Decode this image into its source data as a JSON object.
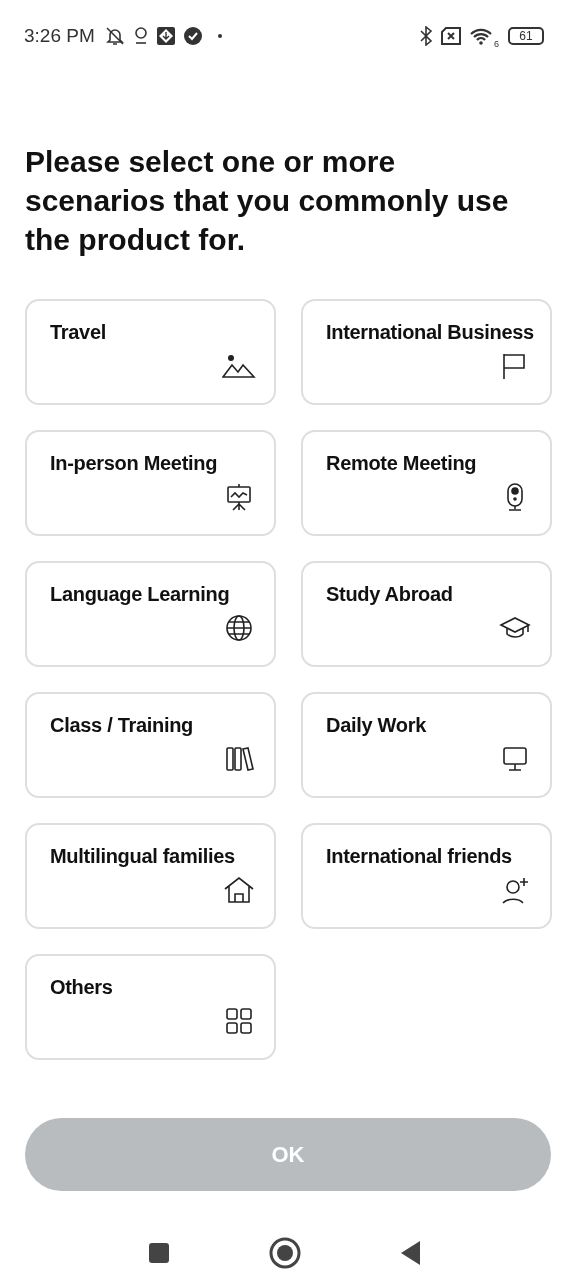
{
  "status_bar": {
    "time": "3:26 PM",
    "wifi_badge": "6",
    "battery": "61"
  },
  "title": "Please select one or more scenarios that you commonly use the product for.",
  "scenarios": [
    {
      "label": "Travel",
      "kind": "mountains",
      "selected": false
    },
    {
      "label": "International Business",
      "kind": "flag",
      "selected": false
    },
    {
      "label": "In-person Meeting",
      "kind": "presentation",
      "selected": false
    },
    {
      "label": "Remote Meeting",
      "kind": "webcam",
      "selected": false
    },
    {
      "label": "Language Learning",
      "kind": "globe",
      "selected": false
    },
    {
      "label": "Study Abroad",
      "kind": "graduation",
      "selected": false
    },
    {
      "label": "Class / Training",
      "kind": "books",
      "selected": false
    },
    {
      "label": "Daily Work",
      "kind": "monitor",
      "selected": false
    },
    {
      "label": "Multilingual families",
      "kind": "house",
      "selected": false
    },
    {
      "label": "International friends",
      "kind": "person-add",
      "selected": false
    },
    {
      "label": "Others",
      "kind": "grid",
      "selected": false
    }
  ],
  "ok_button": {
    "label": "OK",
    "disabled": true
  }
}
